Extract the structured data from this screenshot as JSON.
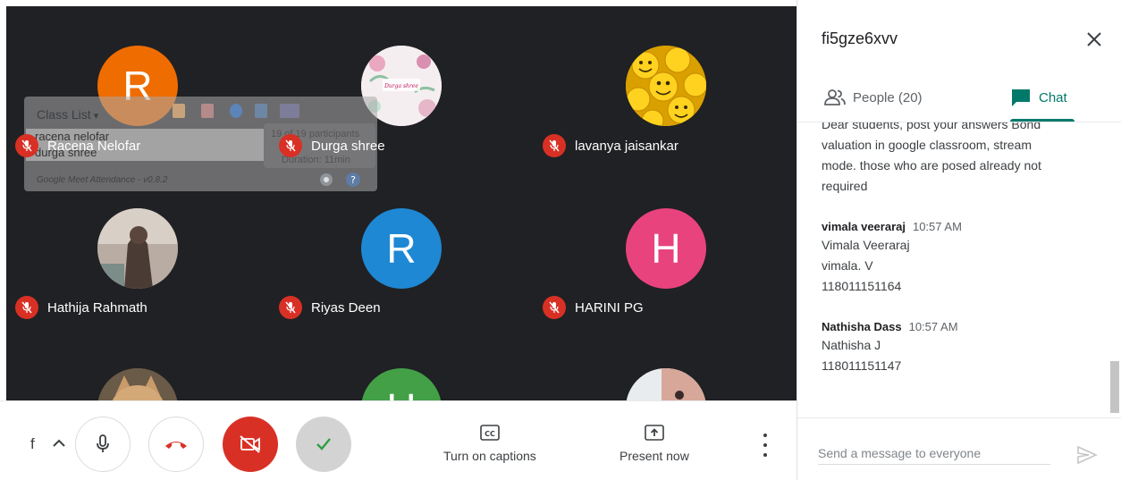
{
  "participants": [
    {
      "name": "Racena Nelofar",
      "avatar_letter": "R",
      "avatar_color": "#ef6c00",
      "muted": true
    },
    {
      "name": "Durga shree",
      "avatar_letter": "",
      "avatar_color": "#f3e6ea",
      "muted": true
    },
    {
      "name": "lavanya jaisankar",
      "avatar_letter": "",
      "avatar_color": "#e8b300",
      "muted": true
    },
    {
      "name": "Hathija Rahmath",
      "avatar_letter": "",
      "avatar_color": "#8a7a70",
      "muted": true
    },
    {
      "name": "Riyas Deen",
      "avatar_letter": "R",
      "avatar_color": "#1a73e8",
      "muted": true
    },
    {
      "name": "HARINI PG",
      "avatar_letter": "H",
      "avatar_color": "#e8437d",
      "muted": true
    },
    {
      "name": "",
      "avatar_letter": "",
      "avatar_color": "#a07850"
    },
    {
      "name": "",
      "avatar_letter": "H",
      "avatar_color": "#43a047"
    },
    {
      "name": "",
      "avatar_letter": "",
      "avatar_color": "#e0c8c0"
    }
  ],
  "extension": {
    "title": "Class List",
    "list": [
      "racena nelofar",
      "durga shree"
    ],
    "participants_text": "19 of 19 participants",
    "duration_text": "Duration: 11min",
    "footer": "Google Meet Attendance - v0.8.2"
  },
  "controls": {
    "pin_letter": "f",
    "captions_label": "Turn on captions",
    "present_label": "Present now"
  },
  "panel": {
    "meeting_code": "fi5gze6xvv",
    "people_tab": "People (20)",
    "chat_tab": "Chat",
    "messages": [
      {
        "sender": "",
        "time": "",
        "lines": [
          "Dear students, post your answers Bond",
          "valuation  in google classroom, stream",
          "mode. those who are posed already not",
          "required"
        ]
      },
      {
        "sender": "vimala veeraraj",
        "time": "10:57 AM",
        "lines": [
          "Vimala Veeraraj",
          "vimala. V",
          "118011151164"
        ]
      },
      {
        "sender": "Nathisha Dass",
        "time": "10:57 AM",
        "lines": [
          "Nathisha J",
          "118011151147"
        ]
      }
    ],
    "input_placeholder": "Send a message to everyone"
  },
  "colors": {
    "accent": "#00796b",
    "mute_red": "#d93025",
    "grid_bg": "#202124"
  }
}
